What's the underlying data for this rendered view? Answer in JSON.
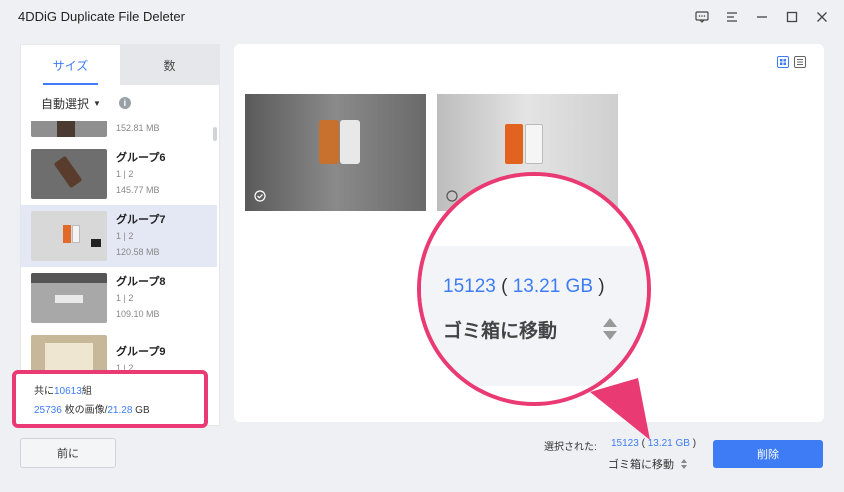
{
  "app": {
    "title": "4DDiG Duplicate File Deleter"
  },
  "left_panel": {
    "tabs": [
      {
        "label": "サイズ"
      },
      {
        "label": "数"
      }
    ],
    "auto_select_label": "自動選択",
    "partial_top_size": "152.81 MB",
    "groups": [
      {
        "name": "グループ6",
        "count": "1 | 2",
        "size": "145.77 MB"
      },
      {
        "name": "グループ7",
        "count": "1 | 2",
        "size": "120.58 MB",
        "selected": true
      },
      {
        "name": "グループ8",
        "count": "1 | 2",
        "size": "109.10 MB"
      },
      {
        "name": "グループ9",
        "count": "1 | 2",
        "size": ""
      }
    ],
    "summary": {
      "line1_prefix": "共に",
      "groups_total": "10613",
      "line1_suffix": "組",
      "images_total": "25736",
      "line2_middle": " 枚の画像/",
      "size_total": "21.28",
      "line2_suffix": " GB"
    },
    "prev_button": "前に"
  },
  "photos": [
    {
      "checked": true
    },
    {
      "checked": false
    }
  ],
  "magnifier": {
    "count": "15123",
    "size": "13.21 GB",
    "trash_label": "ゴミ箱に移動"
  },
  "bottom": {
    "selected_label": "選択された:",
    "selected_count": "15123",
    "selected_size": "13.21 GB",
    "move_to_trash": "ゴミ箱に移動",
    "delete_button": "削除"
  },
  "colors": {
    "accent": "#3d7cf5",
    "highlight": "#ea3a73"
  }
}
